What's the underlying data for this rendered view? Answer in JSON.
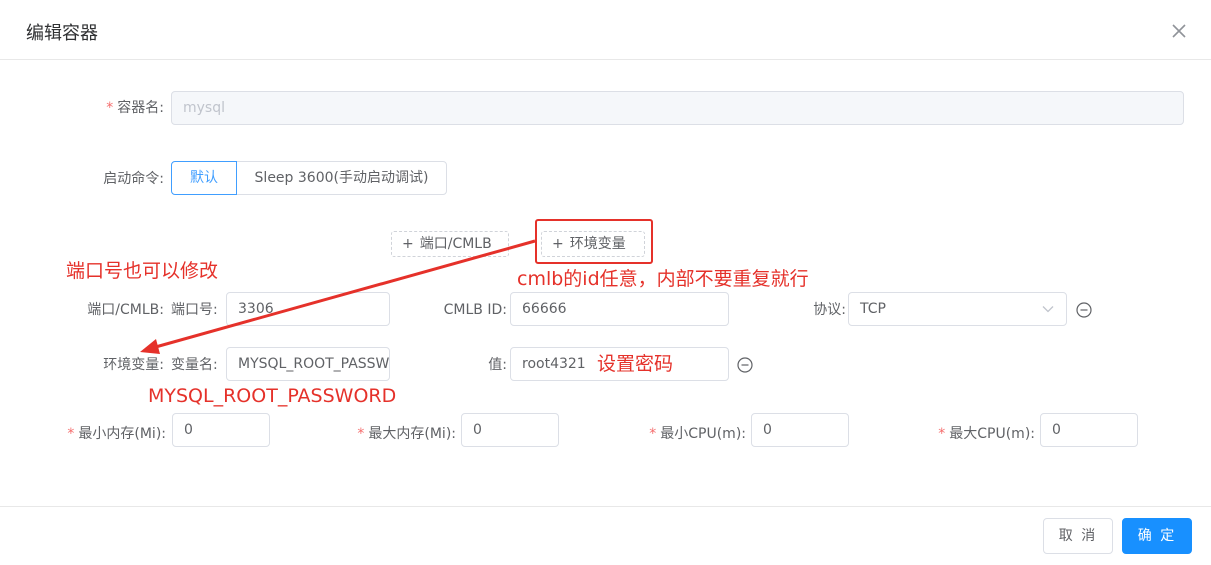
{
  "dialog": {
    "title": "编辑容器"
  },
  "fields": {
    "container_name": {
      "label": "容器名:",
      "value": "mysql"
    },
    "startup_command": {
      "label": "启动命令:",
      "options": [
        "默认",
        "Sleep 3600(手动启动调试)"
      ]
    },
    "add_port": "端口/CMLB",
    "add_env": "环境变量",
    "port_row": {
      "label": "端口/CMLB:",
      "port_label": "端口号:",
      "port_value": "3306",
      "cmlb_label": "CMLB ID:",
      "cmlb_value": "66666",
      "protocol_label": "协议:",
      "protocol_value": "TCP"
    },
    "env_row": {
      "label": "环境变量:",
      "name_label": "变量名:",
      "name_value": "MYSQL_ROOT_PASSWORD",
      "value_label": "值:",
      "value_value": "root4321"
    },
    "resources": {
      "min_mem_label": "最小内存(Mi):",
      "min_mem_value": "0",
      "max_mem_label": "最大内存(Mi):",
      "max_mem_value": "0",
      "min_cpu_label": "最小CPU(m):",
      "min_cpu_value": "0",
      "max_cpu_label": "最大CPU(m):",
      "max_cpu_value": "0"
    }
  },
  "annotations": {
    "port_note": "端口号也可以修改",
    "cmlb_note": "cmlb的id任意，内部不要重复就行",
    "password_note": "设置密码",
    "env_name_note": "MYSQL_ROOT_PASSWORD",
    "color": "#e5312a"
  },
  "footer": {
    "cancel": "取 消",
    "confirm": "确 定"
  },
  "colors": {
    "primary": "#1890ff",
    "required": "#f56c6c"
  }
}
